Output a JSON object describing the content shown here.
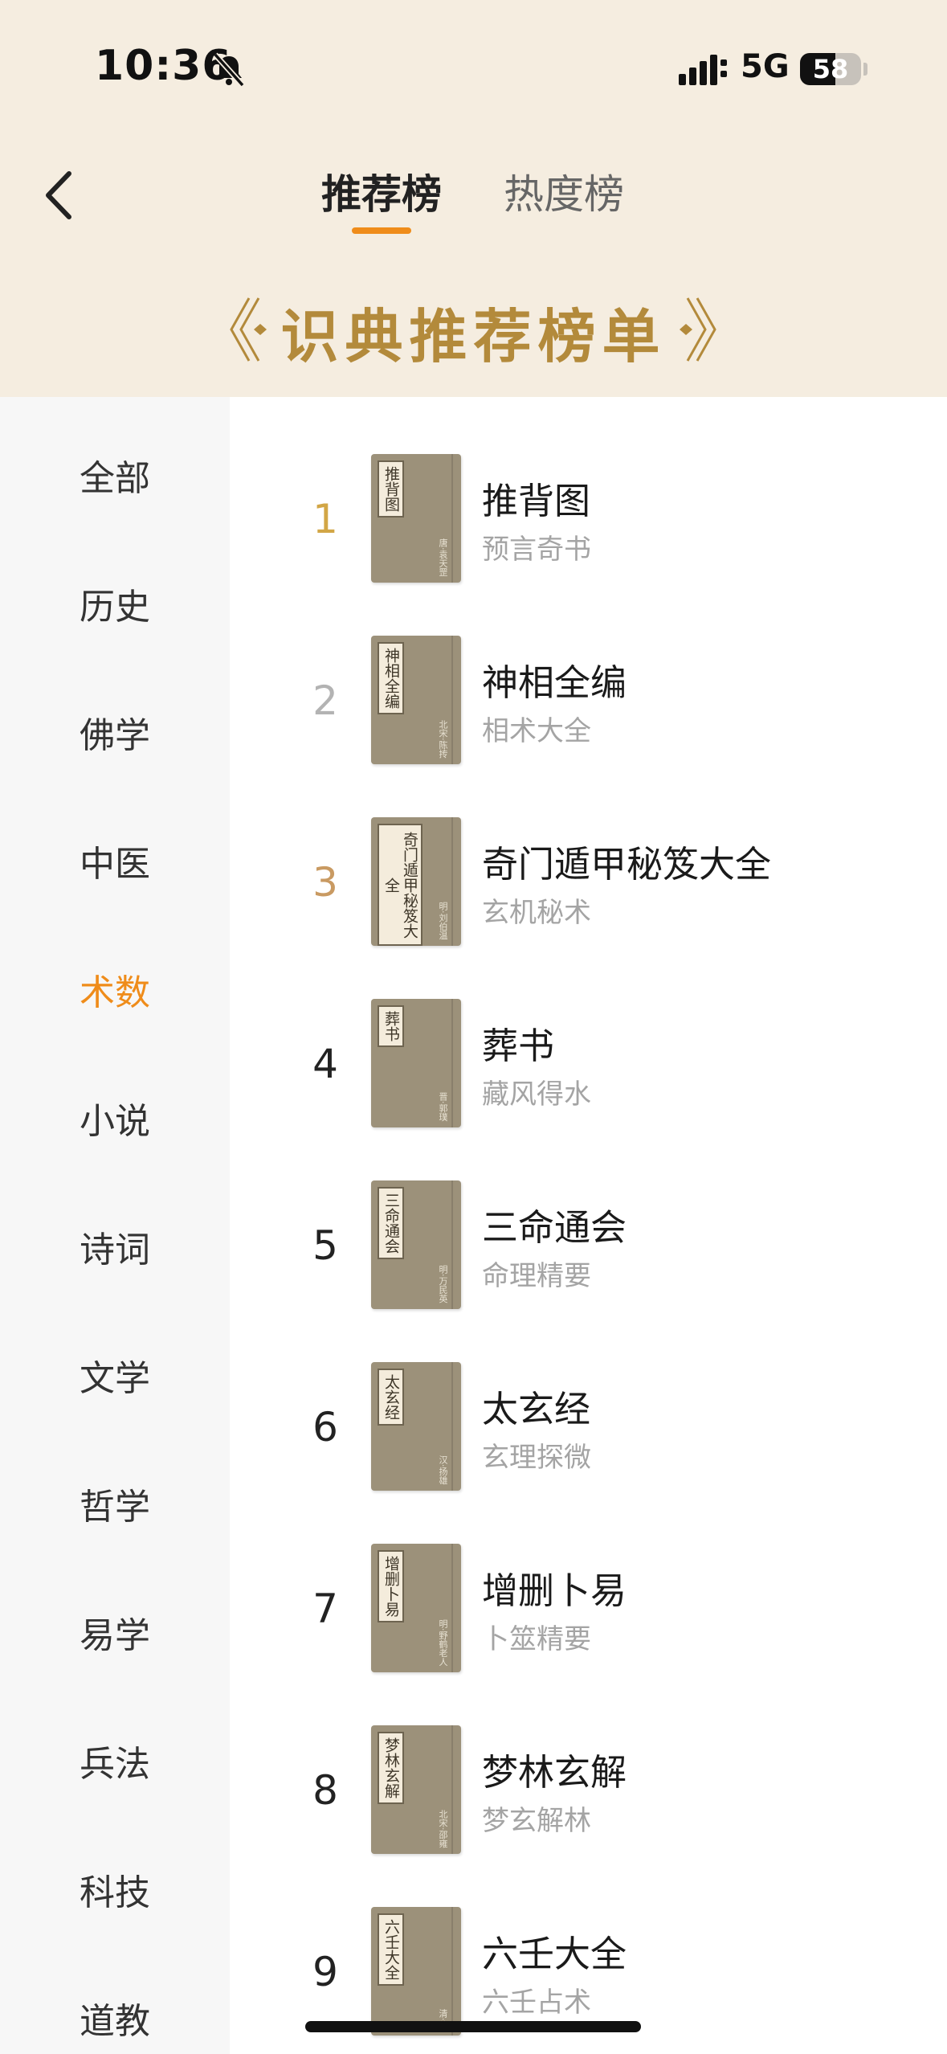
{
  "status_bar": {
    "time": "10:36",
    "network": "5G",
    "battery": "58",
    "battery_level": 0.58
  },
  "nav": {
    "back_icon": "chevron-left-icon",
    "tabs": [
      {
        "label": "推荐榜"
      },
      {
        "label": "热度榜"
      }
    ]
  },
  "banner": {
    "title": "识典推荐榜单"
  },
  "sidebar": {
    "items": [
      {
        "label": "全部"
      },
      {
        "label": "历史"
      },
      {
        "label": "佛学"
      },
      {
        "label": "中医"
      },
      {
        "label": "术数"
      },
      {
        "label": "小说"
      },
      {
        "label": "诗词"
      },
      {
        "label": "文学"
      },
      {
        "label": "哲学"
      },
      {
        "label": "易学"
      },
      {
        "label": "兵法"
      },
      {
        "label": "科技"
      },
      {
        "label": "道教"
      }
    ]
  },
  "books": [
    {
      "rank": "1",
      "title": "推背图",
      "subtitle": "预言奇书",
      "cover_label": "推背图",
      "cover_author": "唐·袁天罡"
    },
    {
      "rank": "2",
      "title": "神相全编",
      "subtitle": "相术大全",
      "cover_label": "神相全编",
      "cover_author": "北宋·陈抟"
    },
    {
      "rank": "3",
      "title": "奇门遁甲秘笈大全",
      "subtitle": "玄机秘术",
      "cover_label": "奇门遁甲秘笈大全",
      "cover_author": "明·刘伯温"
    },
    {
      "rank": "4",
      "title": "葬书",
      "subtitle": "藏风得水",
      "cover_label": "葬书",
      "cover_author": "晋·郭璞"
    },
    {
      "rank": "5",
      "title": "三命通会",
      "subtitle": "命理精要",
      "cover_label": "三命通会",
      "cover_author": "明·万民英"
    },
    {
      "rank": "6",
      "title": "太玄经",
      "subtitle": "玄理探微",
      "cover_label": "太玄经",
      "cover_author": "汉·扬雄"
    },
    {
      "rank": "7",
      "title": "增删卜易",
      "subtitle": "卜筮精要",
      "cover_label": "增删卜易",
      "cover_author": "明·野鹤老人"
    },
    {
      "rank": "8",
      "title": "梦林玄解",
      "subtitle": "梦玄解林",
      "cover_label": "梦林玄解",
      "cover_author": "北宋·邵雍"
    },
    {
      "rank": "9",
      "title": "六壬大全",
      "subtitle": "六壬占术",
      "cover_label": "六壬大全",
      "cover_author": "清·佚"
    }
  ],
  "colors": {
    "accent": "#ef8c1a",
    "header_bg": "#f5ede0",
    "banner_gold": "#b38a3b",
    "rank_1": "#d2a646",
    "rank_2": "#b3b3b3",
    "rank_3": "#c99a62",
    "rank_default": "#222222"
  }
}
